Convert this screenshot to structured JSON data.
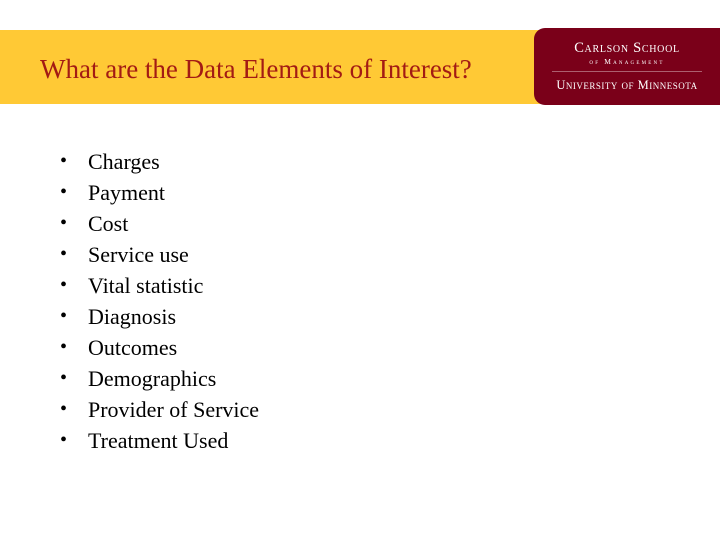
{
  "slide": {
    "title": "What are the Data Elements of Interest?",
    "title_color": "#a31b14",
    "banner_color": "#ffc935",
    "background_color": "#ffffff"
  },
  "logo": {
    "name": "carlson-school-logo",
    "line1": "Carlson School",
    "line2": "of Management",
    "line3": "University of Minnesota",
    "background_color": "#7a0019",
    "text_color": "#ffffff"
  },
  "content": {
    "bullet_glyph": "•",
    "bullets": [
      {
        "label": "Charges"
      },
      {
        "label": "Payment"
      },
      {
        "label": "Cost"
      },
      {
        "label": "Service use"
      },
      {
        "label": "Vital statistic"
      },
      {
        "label": "Diagnosis"
      },
      {
        "label": "Outcomes"
      },
      {
        "label": "Demographics"
      },
      {
        "label": "Provider of Service"
      },
      {
        "label": "Treatment Used"
      }
    ]
  }
}
